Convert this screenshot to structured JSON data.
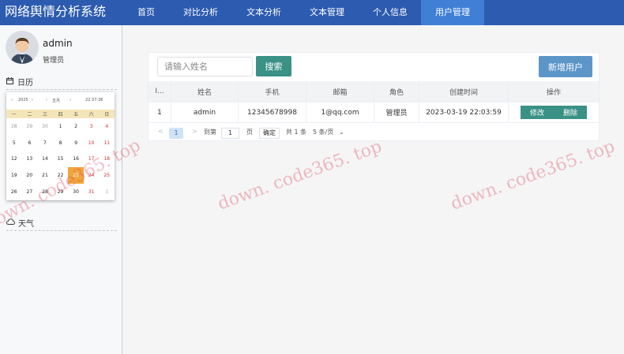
{
  "app": {
    "title": "网络舆情分析系统"
  },
  "nav": {
    "items": [
      {
        "label": "首页"
      },
      {
        "label": "对比分析"
      },
      {
        "label": "文本分析"
      },
      {
        "label": "文本管理"
      },
      {
        "label": "个人信息"
      },
      {
        "label": "用户管理",
        "active": true
      }
    ]
  },
  "user": {
    "name": "admin",
    "role": "管理员"
  },
  "calendar": {
    "heading": "日历",
    "year": "2025",
    "month": "五月",
    "time": "22:37:36",
    "weekdays": [
      "一",
      "二",
      "三",
      "四",
      "五",
      "六",
      "日"
    ],
    "weeks": [
      [
        "28",
        "29",
        "30",
        "1",
        "2",
        "3",
        "4"
      ],
      [
        "5",
        "6",
        "7",
        "8",
        "9",
        "10",
        "11"
      ],
      [
        "12",
        "13",
        "14",
        "15",
        "16",
        "17",
        "18"
      ],
      [
        "19",
        "20",
        "21",
        "22",
        "23",
        "24",
        "25"
      ],
      [
        "26",
        "27",
        "28",
        "29",
        "30",
        "31",
        "1"
      ]
    ],
    "today": "23"
  },
  "weather": {
    "label": "天气"
  },
  "search": {
    "placeholder": "请输入姓名",
    "button": "搜索"
  },
  "add_user_button": "新增用户",
  "table": {
    "columns": [
      "I...",
      "姓名",
      "手机",
      "邮箱",
      "角色",
      "创建时间",
      "操作"
    ],
    "rows": [
      {
        "id": "1",
        "name": "admin",
        "phone": "12345678998",
        "email": "1@qq.com",
        "role": "管理员",
        "created": "2023-03-19 22:03:59"
      }
    ],
    "edit_label": "修改",
    "delete_label": "删除"
  },
  "pagination": {
    "prev": "<",
    "current_page": "1",
    "next": ">",
    "goto_label": "到第",
    "goto_value": "1",
    "page_unit": "页",
    "confirm": "确定",
    "total": "共 1 条",
    "page_size": "5 条/页"
  },
  "watermarks": [
    "down. code365. top",
    "down. code365. top",
    "down. code365. top"
  ],
  "colors": {
    "nav_bg": "#2c5bb0",
    "nav_active": "#3f7fd6",
    "teal": "#3a9186",
    "add_button": "#5c96c8",
    "today": "#f1a53a"
  }
}
